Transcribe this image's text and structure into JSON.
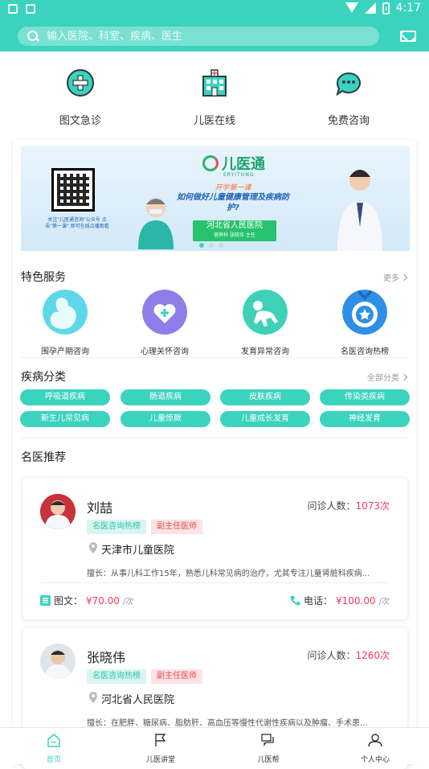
{
  "status": {
    "time": "4:17"
  },
  "search": {
    "placeholder": "输入医院、科室、疾病、医生"
  },
  "quick_actions": [
    {
      "label": "图文急诊",
      "icon": "plus-circle-icon"
    },
    {
      "label": "儿医在线",
      "icon": "hospital-icon"
    },
    {
      "label": "免费咨询",
      "icon": "chat-bubble-icon"
    }
  ],
  "banner": {
    "brand": "儿医通",
    "brand_sub": "ERYITONG",
    "topic_small": "开学第一课",
    "topic_main": "如何做好儿童健康管理及疾病防护?",
    "hospital": "河北省人民医院",
    "doctor": "营养科 张晓伟 主任",
    "qr_caption": "关注\"儿医通咨询\"公众号 点击\"第一课\" 即可在线点播观看"
  },
  "featured": {
    "title": "特色服务",
    "more": "更多",
    "items": [
      {
        "label": "围孕产期咨询",
        "color": "#5ed8e8"
      },
      {
        "label": "心理关怀咨询",
        "color": "#8e7ee9"
      },
      {
        "label": "发育异常咨询",
        "color": "#3ed1b8"
      },
      {
        "label": "名医咨询热榜",
        "color": "#2e8fe6"
      }
    ]
  },
  "disease": {
    "title": "疾病分类",
    "more": "全部分类",
    "tags": [
      "呼吸道疾病",
      "肠道疾病",
      "皮肤疾病",
      "传染类疾病",
      "新生儿常见病",
      "儿童惊厥",
      "儿童成长发育",
      "神经发育"
    ]
  },
  "recommend": {
    "title": "名医推荐",
    "visits_label": "问诊人数：",
    "doctors": [
      {
        "name": "刘喆",
        "visits": "1073次",
        "badge1": "名医咨询热榜",
        "badge2": "副主任医师",
        "hospital": "天津市儿童医院",
        "intro": "擅长：从事儿科工作15年，熟悉儿科常见病的治疗，尤其专注儿童肾脏科疾病...",
        "text_label": "图文：",
        "text_price": "¥70.00",
        "phone_label": "电话：",
        "phone_price": "¥100.00",
        "unit": "/次"
      },
      {
        "name": "张晓伟",
        "visits": "1260次",
        "badge1": "名医咨询热榜",
        "badge2": "副主任医师",
        "hospital": "河北省人民医院",
        "intro": "擅长：在肥胖、糖尿病、脂肪肝、高血压等慢性代谢性疾病以及肿瘤、手术患..."
      }
    ]
  },
  "tabbar": [
    {
      "label": "首页",
      "icon": "home-icon",
      "active": true
    },
    {
      "label": "儿医讲堂",
      "icon": "flag-icon",
      "active": false
    },
    {
      "label": "儿医帮",
      "icon": "chat-icon",
      "active": false
    },
    {
      "label": "个人中心",
      "icon": "user-icon",
      "active": false
    }
  ],
  "colors": {
    "accent": "#3bd3bd",
    "price": "#ef3b5b"
  }
}
